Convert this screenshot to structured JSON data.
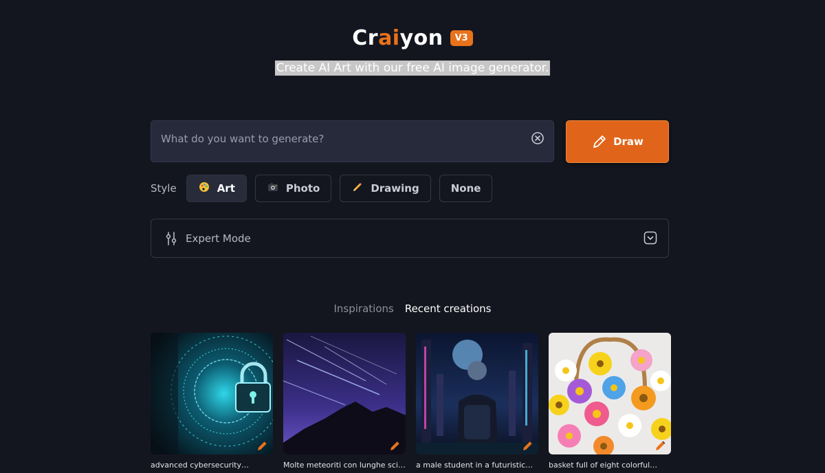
{
  "brand": {
    "part1": "Cr",
    "part2": "ai",
    "part3": "yon",
    "version": "V3",
    "accent_color": "#e8721c"
  },
  "tagline": "Create AI Art with our free AI image generator.",
  "prompt": {
    "placeholder": "What do you want to generate?",
    "value": "",
    "clear_icon": "circle-x-icon"
  },
  "draw_button": {
    "label": "Draw",
    "icon": "pencil-icon",
    "color": "#e0651a"
  },
  "style": {
    "label": "Style",
    "options": [
      {
        "label": "Art",
        "icon": "palette-icon",
        "selected": true
      },
      {
        "label": "Photo",
        "icon": "camera-icon",
        "selected": false
      },
      {
        "label": "Drawing",
        "icon": "pencil-icon",
        "selected": false
      },
      {
        "label": "None",
        "icon": "",
        "selected": false
      }
    ]
  },
  "expert_mode": {
    "label": "Expert Mode",
    "icon": "sliders-icon",
    "toggle_icon": "chevron-down-icon"
  },
  "tabs": [
    {
      "label": "Inspirations",
      "active": false
    },
    {
      "label": "Recent creations",
      "active": true
    }
  ],
  "gallery": [
    {
      "caption": "advanced cybersecurity…",
      "image": "cyber-lock-image"
    },
    {
      "caption": "Molte meteoriti con lunghe sci…",
      "image": "meteor-night-image"
    },
    {
      "caption": "a male student in a futuristic…",
      "image": "futuristic-student-image"
    },
    {
      "caption": "basket full of eight colorful…",
      "image": "flower-basket-image"
    }
  ]
}
